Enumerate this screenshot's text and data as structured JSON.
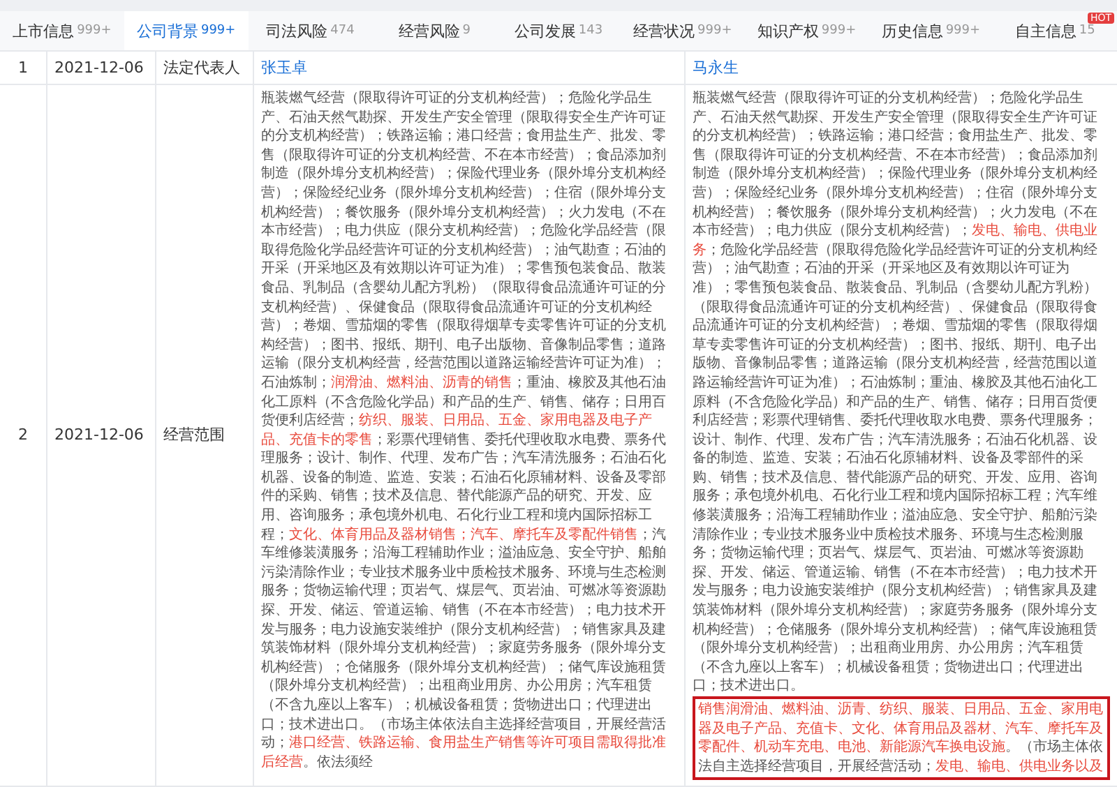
{
  "tabs": [
    {
      "label": "上市信息",
      "count": "999+",
      "selected": false
    },
    {
      "label": "公司背景",
      "count": "999+",
      "selected": true
    },
    {
      "label": "司法风险",
      "count": "474",
      "selected": false
    },
    {
      "label": "经营风险",
      "count": "9",
      "selected": false
    },
    {
      "label": "公司发展",
      "count": "143",
      "selected": false
    },
    {
      "label": "经营状况",
      "count": "999+",
      "selected": false
    },
    {
      "label": "知识产权",
      "count": "999+",
      "selected": false
    },
    {
      "label": "历史信息",
      "count": "999+",
      "selected": false
    },
    {
      "label": "自主信息",
      "count": "15",
      "selected": false,
      "badge": "HOT"
    }
  ],
  "rows": [
    {
      "index": "1",
      "date": "2021-12-06",
      "field": "法定代表人",
      "kind": "person",
      "before": "张玉卓",
      "after": "马永生"
    },
    {
      "index": "2",
      "date": "2021-12-06",
      "field": "经营范围",
      "kind": "scope",
      "before": {
        "segments": [
          {
            "text": "瓶装燃气经营（限取得许可证的分支机构经营）；危险化学品生产、石油天然气勘探、开发生产安全管理（限取得安全生产许可证的分支机构经营）；铁路运输；港口经营；食用盐生产、批发、零售（限取得许可证的分支机构经营、不在本市经营）；食品添加剂制造（限外埠分支机构经营）；保险代理业务（限外埠分支机构经营）；保险经纪业务（限外埠分支机构经营）；住宿（限外埠分支机构经营）；餐饮服务（限外埠分支机构经营）；火力发电（不在本市经营）；电力供应（限分支机构经营）；危险化学品经营（限取得危险化学品经营许可证的分支机构经营）；油气勘查；石油的开采（开采地区及有效期以许可证为准）；零售预包装食品、散装食品、乳制品（含婴幼儿配方乳粉）（限取得食品流通许可证的分支机构经营）、保健食品（限取得食品流通许可证的分支机构经营）；卷烟、雪茄烟的零售（限取得烟草专卖零售许可证的分支机构经营）；图书、报纸、期刊、电子出版物、音像制品零售；道路运输（限分支机构经营，经营范围以道路运输经营许可证为准）；石油炼制；",
            "highlight": false
          },
          {
            "text": "润滑油、燃料油、沥青的销售",
            "highlight": true
          },
          {
            "text": "；重油、橡胶及其他石油化工原料（不含危险化学品）和产品的生产、销售、储存；日用百货便利店经营；",
            "highlight": false
          },
          {
            "text": "纺织、服装、日用品、五金、家用电器及电子产品、充值卡的零售",
            "highlight": true
          },
          {
            "text": "；彩票代理销售、委托代理收取水电费、票务代理服务；设计、制作、代理、发布广告；汽车清洗服务；石油石化机器、设备的制造、监造、安装；石油石化原辅材料、设备及零部件的采购、销售；技术及信息、替代能源产品的研究、开发、应用、咨询服务；承包境外机电、石化行业工程和境内国际招标工程；",
            "highlight": false
          },
          {
            "text": "文化、体育用品及器材销售；汽车、摩托车及零配件销售",
            "highlight": true
          },
          {
            "text": "；汽车维修装潢服务；沿海工程辅助作业；溢油应急、安全守护、船舶污染清除作业；专业技术服务业中质检技术服务、环境与生态检测服务；货物运输代理；页岩气、煤层气、页岩油、可燃冰等资源勘探、开发、储运、管道运输、销售（不在本市经营）；电力技术开发与服务；电力设施安装维护（限分支机构经营）；销售家具及建筑装饰材料（限外埠分支机构经营）；家庭劳务服务（限外埠分支机构经营）；仓储服务（限外埠分支机构经营）；储气库设施租赁（限外埠分支机构经营）；出租商业用房、办公用房；汽车租赁（不含九座以上客车）；机械设备租赁；货物进出口；代理进出口；技术进出口。（市场主体依法自主选择经营项目，开展经营活动；",
            "highlight": false
          },
          {
            "text": "港口经营、铁路运输、食用盐生产销售等许可项目需取得批准后经营",
            "highlight": true
          },
          {
            "text": "。依法须经",
            "highlight": false
          }
        ]
      },
      "after": {
        "segments": [
          {
            "text": "瓶装燃气经营（限取得许可证的分支机构经营）；危险化学品生产、石油天然气勘探、开发生产安全管理（限取得安全生产许可证的分支机构经营）；铁路运输；港口经营；食用盐生产、批发、零售（限取得许可证的分支机构经营、不在本市经营）；食品添加剂制造（限外埠分支机构经营）；保险代理业务（限外埠分支机构经营）；保险经纪业务（限外埠分支机构经营）；住宿（限外埠分支机构经营）；餐饮服务（限外埠分支机构经营）；火力发电（不在本市经营）；电力供应（限分支机构经营）；",
            "highlight": false
          },
          {
            "text": "发电、输电、供电业务",
            "highlight": true
          },
          {
            "text": "；危险化学品经营（限取得危险化学品经营许可证的分支机构经营）；油气勘查；石油的开采（开采地区及有效期以许可证为准）；零售预包装食品、散装食品、乳制品（含婴幼儿配方乳粉）（限取得食品流通许可证的分支机构经营）、保健食品（限取得食品流通许可证的分支机构经营）；卷烟、雪茄烟的零售（限取得烟草专卖零售许可证的分支机构经营）；图书、报纸、期刊、电子出版物、音像制品零售；道路运输（限分支机构经营，经营范围以道路运输经营许可证为准）；石油炼制；重油、橡胶及其他石油化工原料（不含危险化学品）和产品的生产、销售、储存；日用百货便利店经营；彩票代理销售、委托代理收取水电费、票务代理服务；设计、制作、代理、发布广告；汽车清洗服务；石油石化机器、设备的制造、监造、安装；石油石化原辅材料、设备及零部件的采购、销售；技术及信息、替代能源产品的研究、开发、应用、咨询服务；承包境外机电、石化行业工程和境内国际招标工程；汽车维修装潢服务；沿海工程辅助作业；溢油应急、安全守护、船舶污染清除作业；专业技术服务业中质检技术服务、环境与生态检测服务；货物运输代理；页岩气、煤层气、页岩油、可燃冰等资源勘探、开发、储运、管道运输、销售（不在本市经营）；电力技术开发与服务；电力设施安装维护（限分支机构经营）；销售家具及建筑装饰材料（限外埠分支机构经营）；家庭劳务服务（限外埠分支机构经营）；仓储服务（限外埠分支机构经营）；储气库设施租赁（限外埠分支机构经营）；出租商业用房、办公用房；汽车租赁（不含九座以上客车）；机械设备租赁；货物进出口；代理进出口；技术进出口。",
            "highlight": false
          }
        ],
        "boxed_segments": [
          {
            "text": "销售润滑油、燃料油、沥青、纺织、服装、日用品、五金、家用电器及电子产品、充值卡、文化、体育用品及器材、汽车、摩托车及零配件、机动车充电、电池、新能源汽车换电设施",
            "highlight": true
          },
          {
            "text": "。（市场主体依法自主选择经营项目，开展经营活动；",
            "highlight": false
          },
          {
            "text": "发电、输电、供电业务以及",
            "highlight": true
          }
        ]
      }
    }
  ]
}
